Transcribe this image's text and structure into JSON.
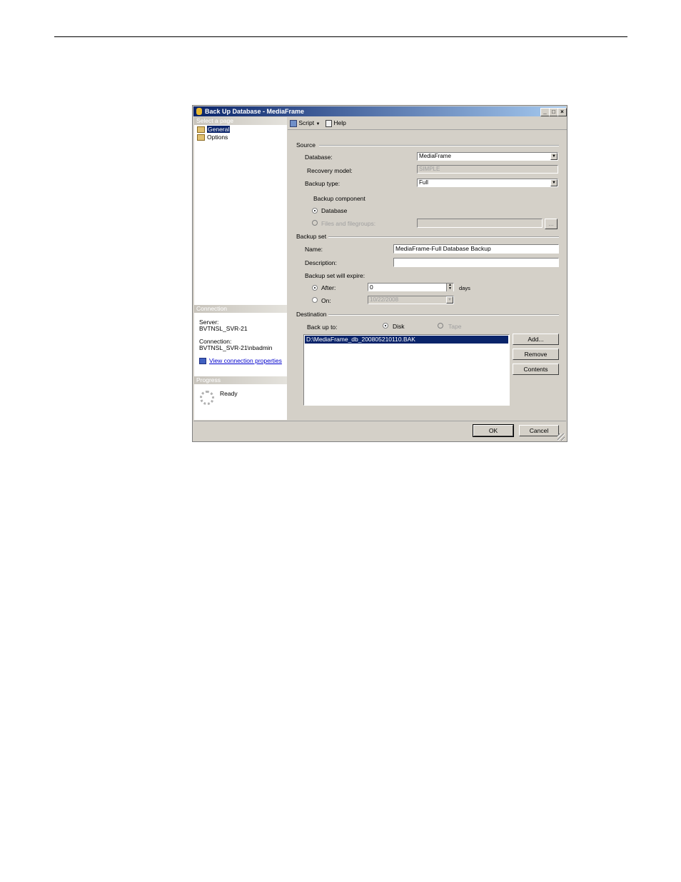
{
  "window": {
    "title": "Back Up Database - MediaFrame"
  },
  "left_panel": {
    "select_page_header": "Select a page",
    "pages": [
      {
        "label": "General"
      },
      {
        "label": "Options"
      }
    ],
    "connection_header": "Connection",
    "server_label": "Server:",
    "server_value": "BVTNSL_SVR-21",
    "connection_label": "Connection:",
    "connection_value": "BVTNSL_SVR-21\\nbadmin",
    "view_props_link": "View connection properties",
    "progress_header": "Progress",
    "progress_status": "Ready"
  },
  "toolbar": {
    "script_label": "Script",
    "help_label": "Help"
  },
  "source": {
    "group_label": "Source",
    "database_label": "Database:",
    "database_value": "MediaFrame",
    "recovery_model_label": "Recovery model:",
    "recovery_model_value": "SIMPLE",
    "backup_type_label": "Backup type:",
    "backup_type_value": "Full",
    "backup_component_label": "Backup component",
    "database_radio_label": "Database",
    "files_radio_label": "Files and filegroups:",
    "browse_label": "..."
  },
  "backup_set": {
    "group_label": "Backup set",
    "name_label": "Name:",
    "name_value": "MediaFrame-Full Database Backup",
    "description_label": "Description:",
    "description_value": "",
    "expire_label": "Backup set will expire:",
    "after_label": "After:",
    "after_value": "0",
    "days_label": "days",
    "on_label": "On:",
    "on_value": "10/22/2008"
  },
  "destination": {
    "group_label": "Destination",
    "backup_to_label": "Back up to:",
    "disk_label": "Disk",
    "tape_label": "Tape",
    "files": [
      "D:\\MediaFrame_db_200805210110.BAK"
    ],
    "add_label": "Add...",
    "remove_label": "Remove",
    "contents_label": "Contents"
  },
  "footer": {
    "ok_label": "OK",
    "cancel_label": "Cancel"
  }
}
